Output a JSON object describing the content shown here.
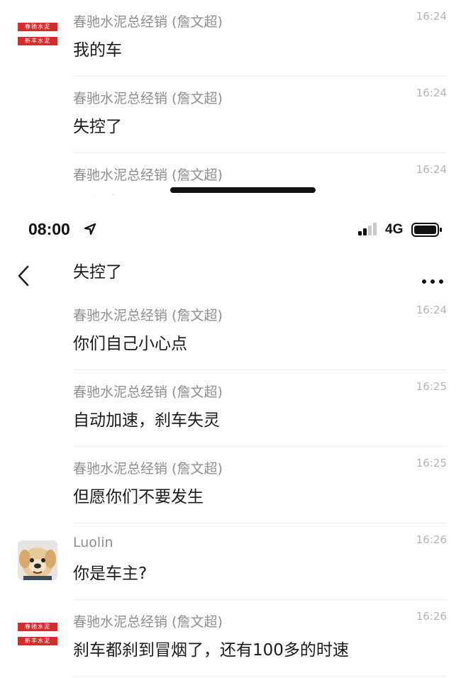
{
  "top_messages": [
    {
      "sender": "春驰水泥总经销 (詹文超)",
      "time": "16:24",
      "text": "我的车",
      "avatar": "brand-logo"
    },
    {
      "sender": "春驰水泥总经销 (詹文超)",
      "time": "16:24",
      "text": "失控了"
    },
    {
      "sender": "春驰水泥总经销 (詹文超)",
      "time": "16:24",
      "text": "你们自己小心点"
    }
  ],
  "status_bar": {
    "time": "08:00",
    "network": "4G"
  },
  "nav": {
    "title": "失控了"
  },
  "messages": [
    {
      "sender": "春驰水泥总经销 (詹文超)",
      "time": "16:24",
      "text": "你们自己小心点"
    },
    {
      "sender": "春驰水泥总经销 (詹文超)",
      "time": "16:25",
      "text": "自动加速，刹车失灵"
    },
    {
      "sender": "春驰水泥总经销 (詹文超)",
      "time": "16:25",
      "text": "但愿你们不要发生"
    },
    {
      "sender": "Luolin",
      "time": "16:26",
      "text": "你是车主?",
      "avatar": "dog-photo"
    },
    {
      "sender": "春驰水泥总经销 (詹文超)",
      "time": "16:26",
      "text": "刹车都刹到冒烟了，还有100多的时速",
      "avatar": "brand-logo"
    }
  ],
  "logo": {
    "line1": "春驰水泥",
    "line2": "新丰水泥"
  },
  "colors": {
    "brand_red": "#d52b2b",
    "meta_gray": "#8e8e8e",
    "divider": "#ececec"
  }
}
